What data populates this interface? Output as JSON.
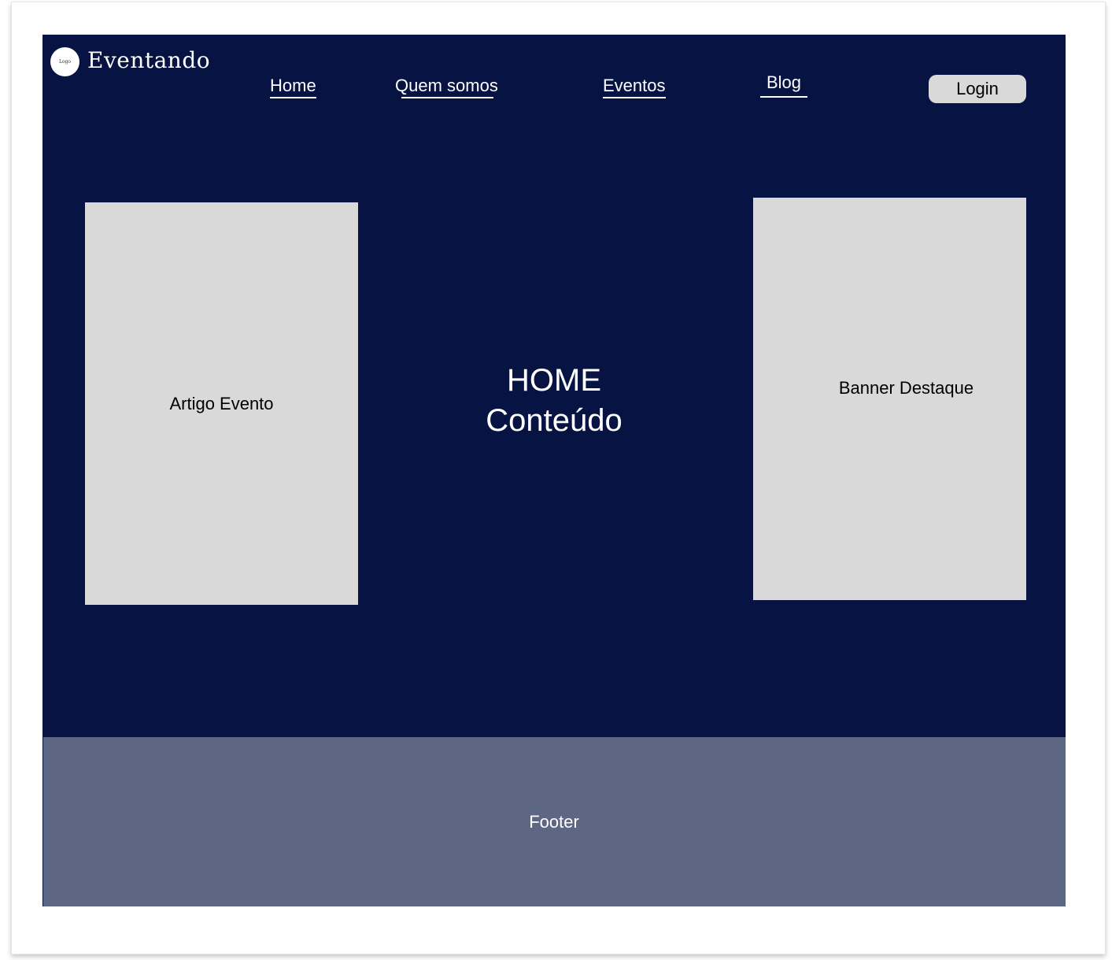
{
  "header": {
    "logo_text": "Logo",
    "brand": "Eventando",
    "nav": {
      "home": "Home",
      "quem_somos": "Quem somos",
      "eventos": "Eventos",
      "blog": "Blog"
    },
    "login_label": "Login"
  },
  "main": {
    "left_card": "Artigo Evento",
    "hero_line1": "HOME",
    "hero_line2": "Conteúdo",
    "right_card": "Banner Destaque"
  },
  "footer": {
    "label": "Footer"
  },
  "colors": {
    "main_bg": "#071342",
    "footer_bg": "#5d6683",
    "card_bg": "#d9d9d9",
    "text_light": "#ffffff"
  }
}
